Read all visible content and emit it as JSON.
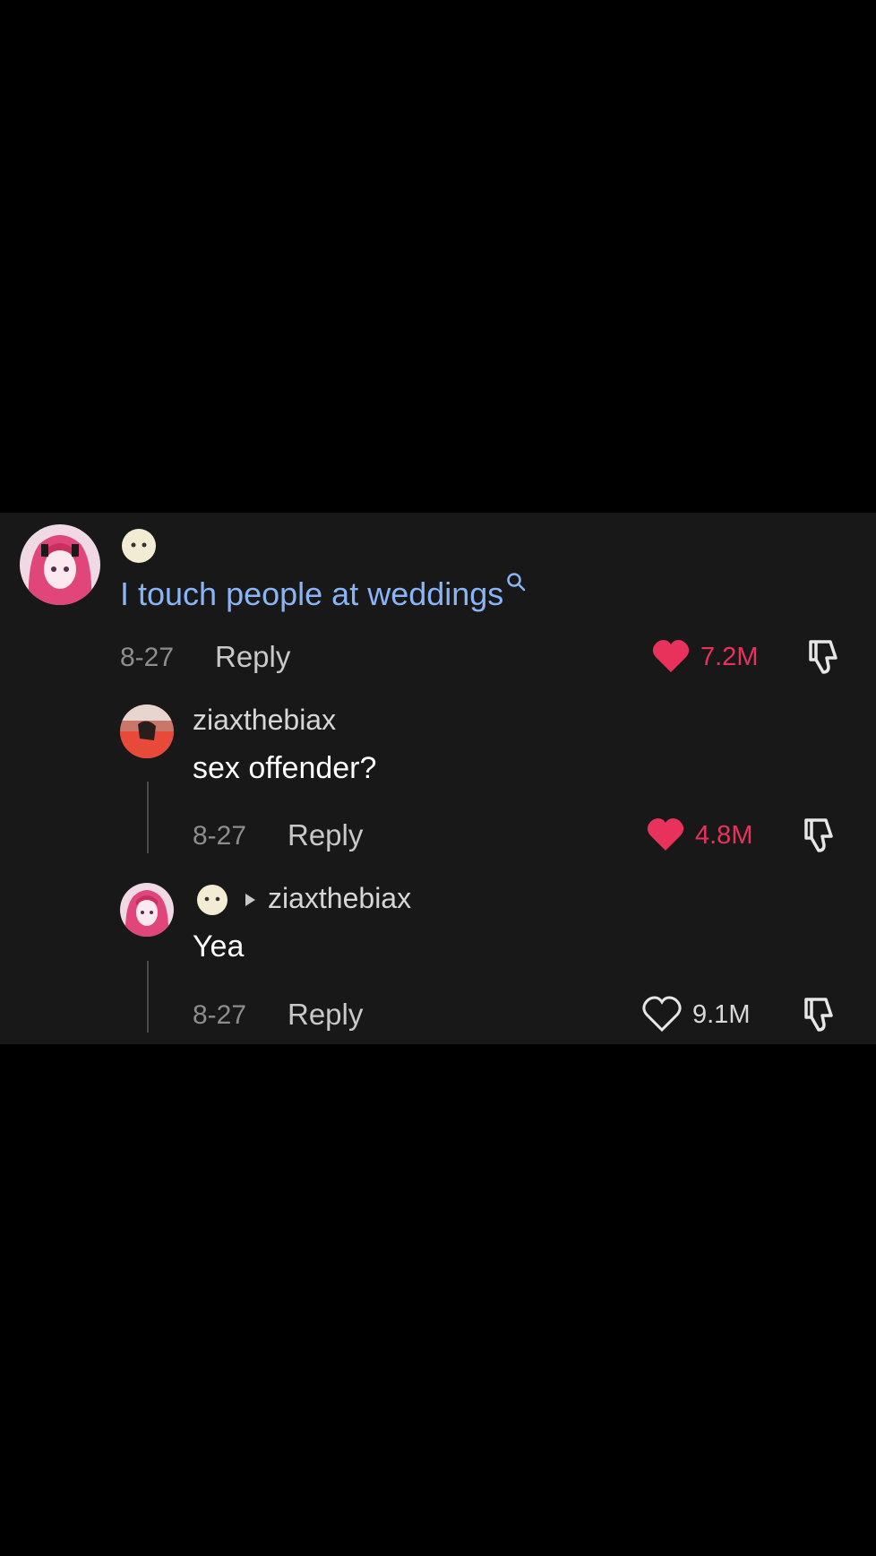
{
  "comments": [
    {
      "text": "I touch people at weddings",
      "date": "8-27",
      "reply_label": "Reply",
      "likes": "7.2M",
      "liked": true
    },
    {
      "username": "ziaxthebiax",
      "text": "sex offender?",
      "date": "8-27",
      "reply_label": "Reply",
      "likes": "4.8M",
      "liked": true
    },
    {
      "reply_to": "ziaxthebiax",
      "text": "Yea",
      "date": "8-27",
      "reply_label": "Reply",
      "likes": "9.1M",
      "liked": false
    }
  ],
  "colors": {
    "background": "#000000",
    "panel": "#181818",
    "liked_heart": "#e8325b",
    "search_link": "#8ab4f8"
  },
  "icons": [
    "heart-icon",
    "dislike-icon",
    "search-icon",
    "reply-arrow-icon"
  ]
}
